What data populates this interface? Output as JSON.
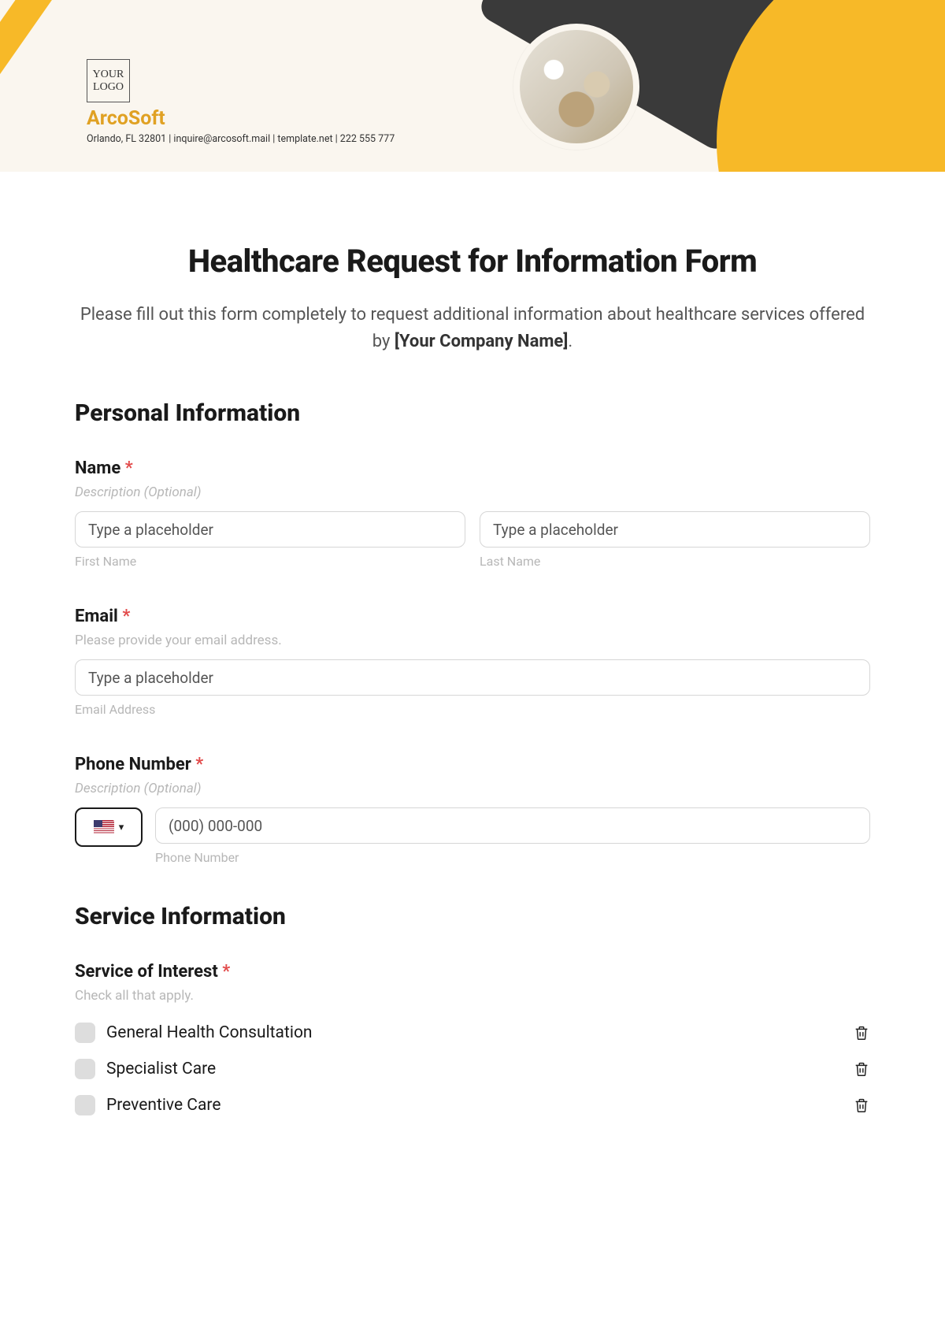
{
  "banner": {
    "logo_text": "YOUR LOGO",
    "company": "ArcoSoft",
    "info": "Orlando, FL 32801 | inquire@arcosoft.mail | template.net | 222 555 777"
  },
  "title": "Healthcare Request for Information Form",
  "subtitle_pre": "Please fill out this form completely to request additional information about healthcare services offered by ",
  "subtitle_bold": "[Your Company Name]",
  "subtitle_post": ".",
  "sections": {
    "personal": {
      "heading": "Personal Information",
      "name": {
        "label": "Name",
        "desc": "Description (Optional)",
        "first_ph": "Type a placeholder",
        "first_sub": "First Name",
        "last_ph": "Type a placeholder",
        "last_sub": "Last Name"
      },
      "email": {
        "label": "Email",
        "desc": "Please provide your email address.",
        "ph": "Type a placeholder",
        "sub": "Email Address"
      },
      "phone": {
        "label": "Phone Number",
        "desc": "Description (Optional)",
        "ph": "(000) 000-000",
        "sub": "Phone Number"
      }
    },
    "service": {
      "heading": "Service Information",
      "interest": {
        "label": "Service of Interest",
        "desc": "Check all that apply.",
        "options": [
          "General Health Consultation",
          "Specialist Care",
          "Preventive Care"
        ]
      }
    }
  },
  "required_mark": "*"
}
